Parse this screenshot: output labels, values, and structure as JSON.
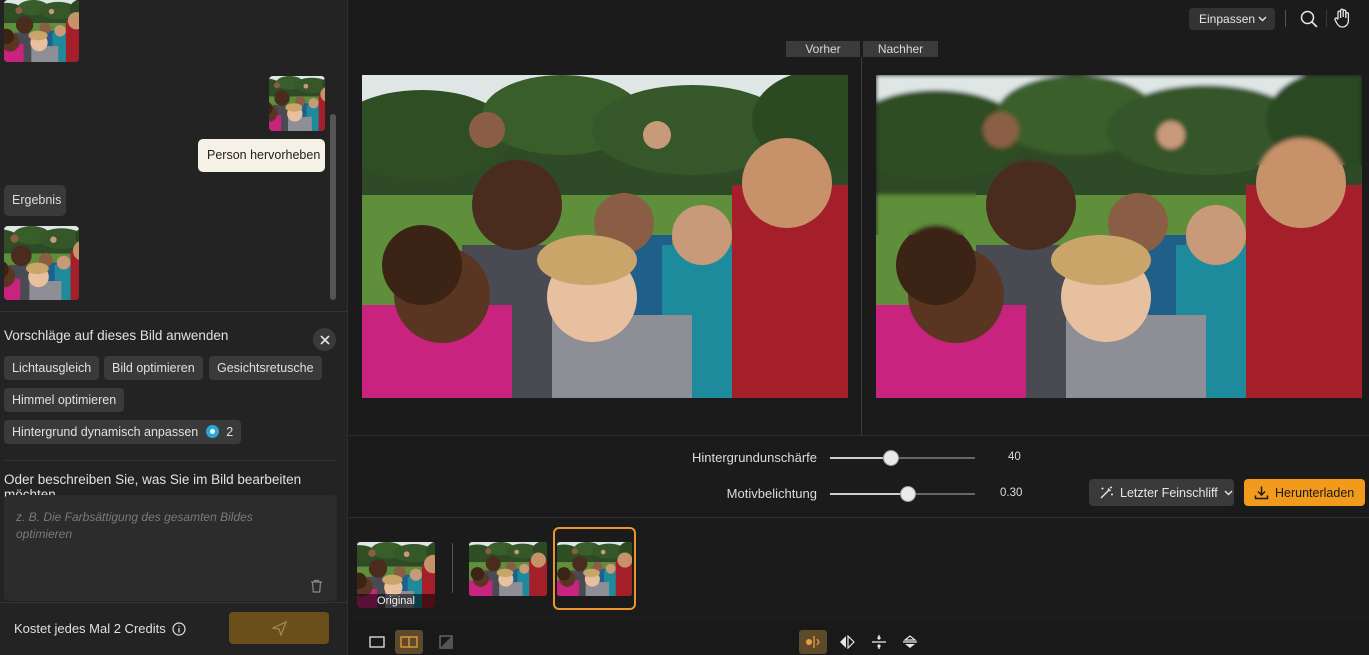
{
  "chat": {
    "user_message": "Person hervorheben",
    "result_label": "Ergebnis"
  },
  "suggestions": {
    "title": "Vorschläge auf dieses Bild anwenden",
    "chips": [
      "Lichtausgleich",
      "Bild optimieren",
      "Gesichtsretusche",
      "Himmel optimieren",
      "Hintergrund dynamisch anpassen"
    ],
    "credit_badge": "2"
  },
  "describe": {
    "label": "Oder beschreiben Sie, was Sie im Bild bearbeiten möchten",
    "placeholder": "z. B. Die Farbsättigung des gesamten Bildes optimieren"
  },
  "footer": {
    "cost_text": "Kostet jedes Mal 2 Credits"
  },
  "toolbar": {
    "fit_label": "Einpassen"
  },
  "compare": {
    "before_label": "Vorher",
    "after_label": "Nachher"
  },
  "sliders": [
    {
      "label": "Hintergrundunschärfe",
      "value_text": "40",
      "fraction": 0.42
    },
    {
      "label": "Motivbelichtung",
      "value_text": "0.30",
      "fraction": 0.54
    }
  ],
  "actions": {
    "finish_label": "Letzter Feinschliff",
    "download_label": "Herunterladen"
  },
  "filmstrip": {
    "original_label": "Original"
  },
  "colors": {
    "accent": "#f29a1c",
    "selected_border": "#e9972a"
  }
}
